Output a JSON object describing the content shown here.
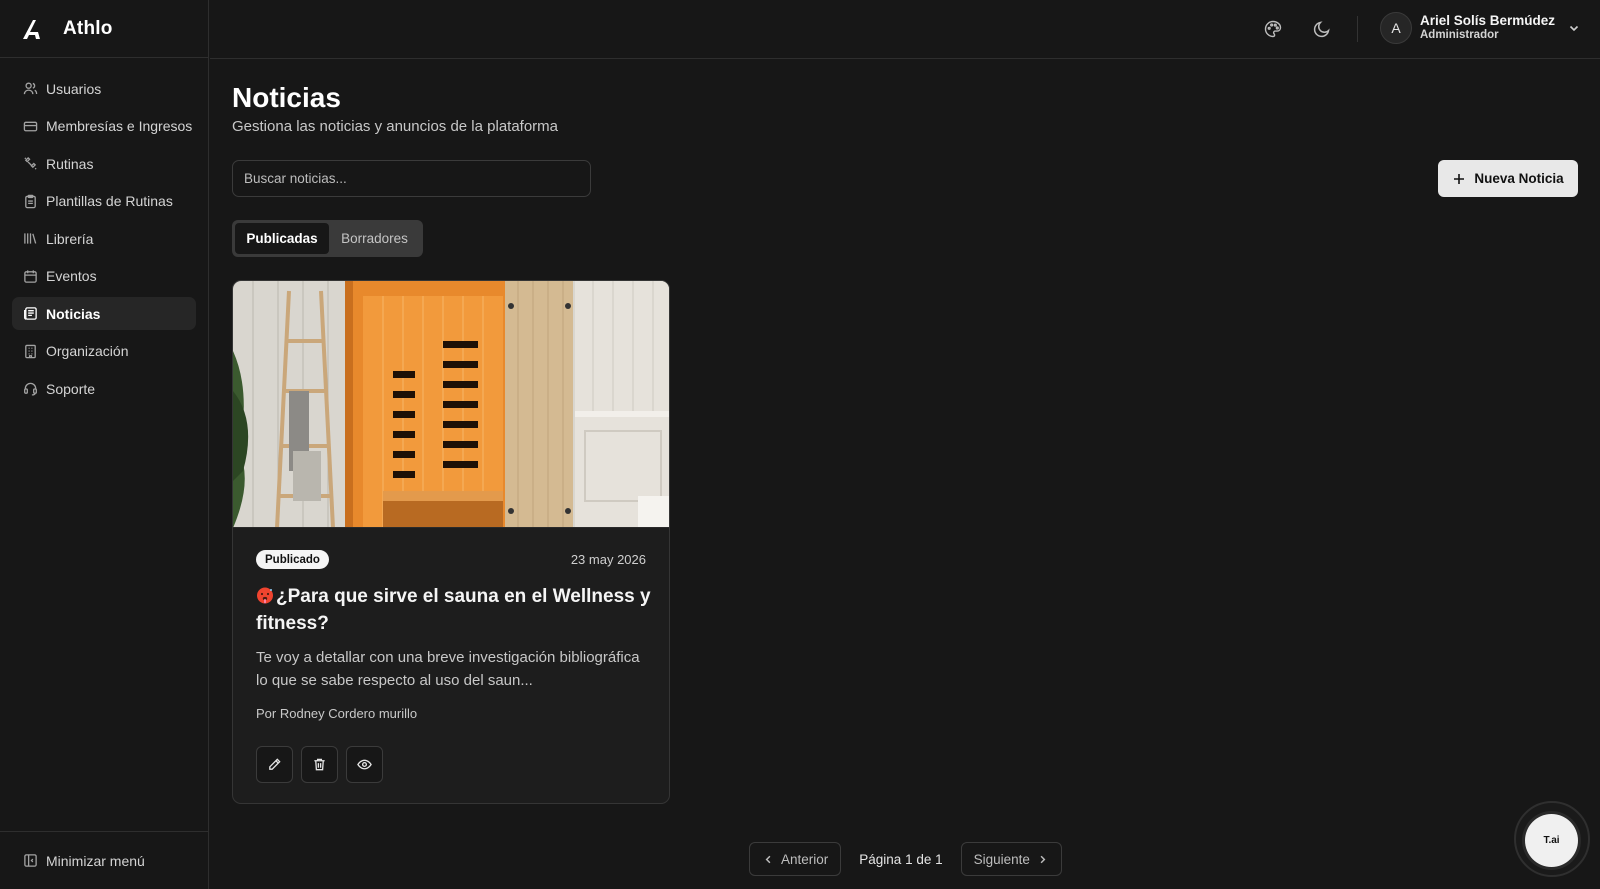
{
  "app": {
    "name": "Athlo"
  },
  "sidebar": {
    "items": [
      {
        "label": "Usuarios",
        "icon": "users-icon",
        "active": false
      },
      {
        "label": "Membresías e Ingresos",
        "icon": "credit-card-icon",
        "active": false
      },
      {
        "label": "Rutinas",
        "icon": "dumbbell-icon",
        "active": false
      },
      {
        "label": "Plantillas de Rutinas",
        "icon": "clipboard-icon",
        "active": false
      },
      {
        "label": "Librería",
        "icon": "library-icon",
        "active": false
      },
      {
        "label": "Eventos",
        "icon": "calendar-icon",
        "active": false
      },
      {
        "label": "Noticias",
        "icon": "newspaper-icon",
        "active": true
      },
      {
        "label": "Organización",
        "icon": "building-icon",
        "active": false
      },
      {
        "label": "Soporte",
        "icon": "headset-icon",
        "active": false
      }
    ],
    "footer_label": "Minimizar menú"
  },
  "header": {
    "user_initial": "A",
    "user_name": "Ariel Solís Bermúdez",
    "user_role": "Administrador",
    "icons": [
      "palette-icon",
      "moon-icon",
      "chevron-down-icon"
    ]
  },
  "main": {
    "title": "Noticias",
    "subtitle": "Gestiona las noticias y anuncios de la plataforma",
    "search_placeholder": "Buscar noticias...",
    "new_button": "Nueva Noticia",
    "tabs": [
      {
        "label": "Publicadas",
        "active": true
      },
      {
        "label": "Borradores",
        "active": false
      }
    ]
  },
  "news": [
    {
      "status": "Publicado",
      "date": "23 may 2026",
      "title": "¿Para que sirve el sauna en el Wellness y fitness?",
      "excerpt": "Te voy a detallar con una breve investigación bibliográfica lo que se sabe respecto al uso del saun...",
      "author": "Por Rodney Cordero murillo",
      "actions": [
        "pencil-icon",
        "trash-icon",
        "eye-icon"
      ]
    }
  ],
  "pagination": {
    "prev": "Anterior",
    "status": "Página 1 de 1",
    "next": "Siguiente"
  },
  "assistant": {
    "label": "T.ai"
  },
  "colors": {
    "background": "#171717",
    "card": "#1d1d1d",
    "accent_button": "#e8e8e8",
    "sauna_wood": "#e8892c"
  }
}
